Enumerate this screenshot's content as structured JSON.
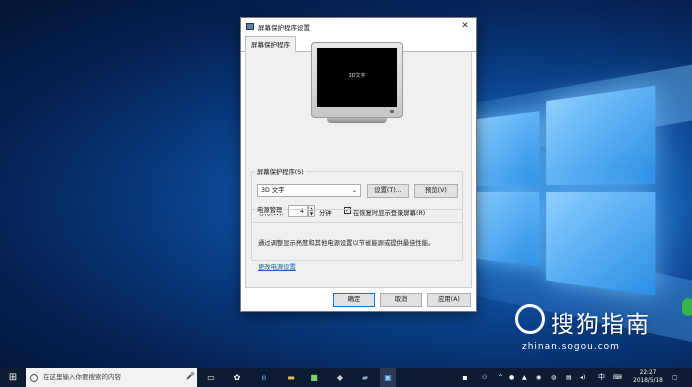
{
  "dialog": {
    "title": "屏幕保护程序设置",
    "close_icon": "✕",
    "tab": "屏幕保护程序",
    "preview_text": "3D文字",
    "saver_group_label": "屏幕保护程序(S)",
    "saver_value": "3D 文字",
    "settings_button": "设置(T)...",
    "preview_button": "预览(V)",
    "wait_label": "等待(W):",
    "wait_value": "4",
    "minutes_label": "分钟",
    "resume_checked": "✓",
    "resume_label": "在恢复时显示登录屏幕(R)",
    "power_group_label": "电源管理",
    "power_desc": "通过调整显示亮度和其他电源设置以节省能源或提供最佳性能。",
    "power_link": "更改电源设置",
    "ok_button": "确定",
    "cancel_button": "取消",
    "apply_button": "应用(A)"
  },
  "taskbar": {
    "search_placeholder": "在这里输入你要搜索的内容",
    "ime": "中",
    "clock_time": "22:27",
    "clock_date": "2018/5/18"
  },
  "watermark": {
    "text": "搜狗指南",
    "url": "zhinan.sogou.com"
  }
}
